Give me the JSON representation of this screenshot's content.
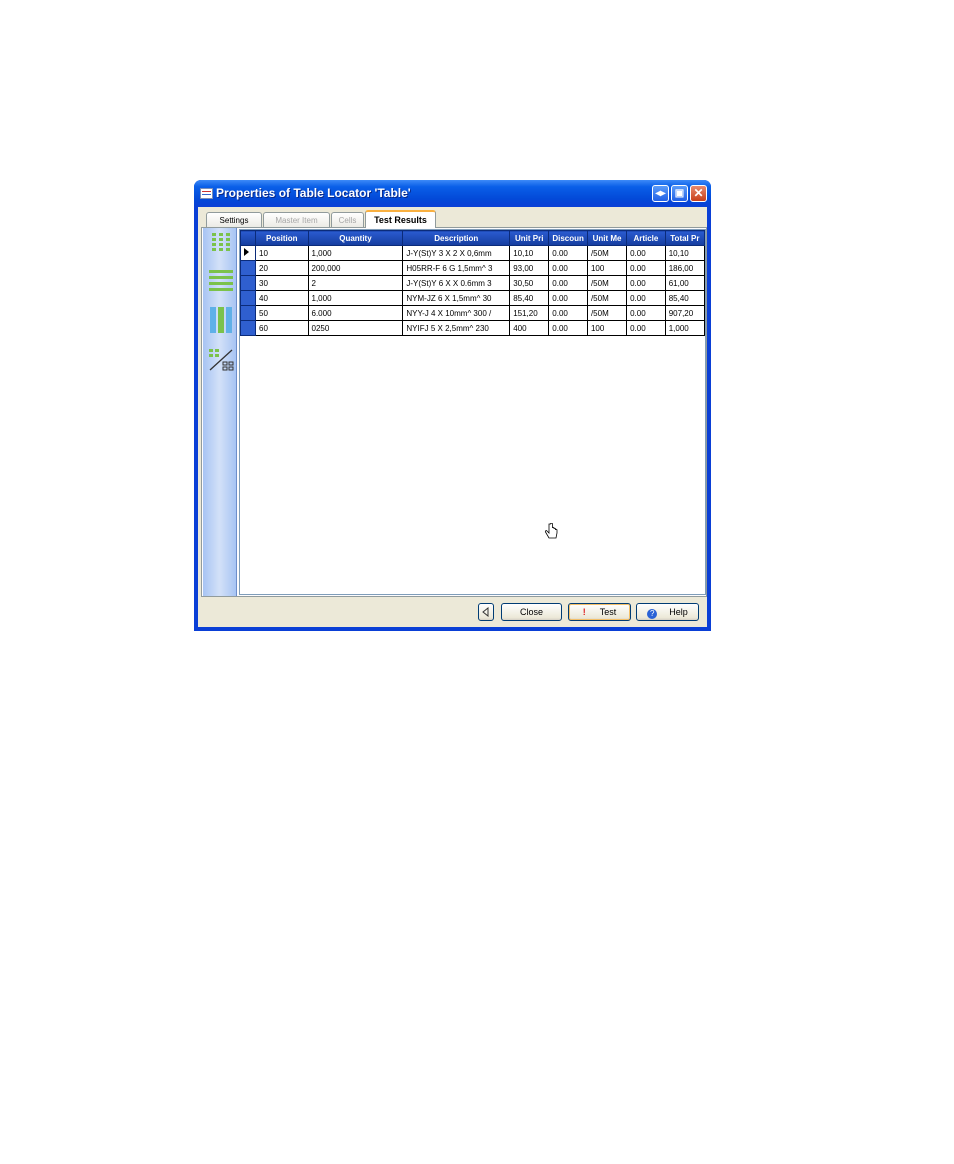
{
  "window": {
    "title": "Properties of Table Locator 'Table'"
  },
  "tabs": [
    {
      "label": "Settings",
      "state": "normal"
    },
    {
      "label": "Master Item",
      "state": "disabled"
    },
    {
      "label": "Cells",
      "state": "disabled"
    },
    {
      "label": "Test Results",
      "state": "active"
    }
  ],
  "toolbar": [
    "columns-grid-icon",
    "rows-grid-icon",
    "column-bars-icon",
    "split-grid-icon"
  ],
  "table": {
    "columns": [
      "Position",
      "Quantity",
      "Description",
      "Unit Pri",
      "Discoun",
      "Unit Me",
      "Article",
      "Total Pr"
    ],
    "rows": [
      [
        "10",
        "1,000",
        "J-Y(St)Y 3 X 2 X 0,6mm",
        "10,10",
        "0.00",
        "/50M",
        "0.00",
        "10,10"
      ],
      [
        "20",
        "200,000",
        "H05RR-F 6 G 1,5mm^ 3",
        "93,00",
        "0.00",
        "100",
        "0.00",
        "186,00"
      ],
      [
        "30",
        "2",
        "J-Y(St)Y 6 X X 0.6mm 3",
        "30,50",
        "0.00",
        "/50M",
        "0.00",
        "61,00"
      ],
      [
        "40",
        "1,000",
        "NYM-JZ 6 X 1,5mm^ 30",
        "85,40",
        "0.00",
        "/50M",
        "0.00",
        "85,40"
      ],
      [
        "50",
        "6.000",
        "NYY-J 4 X 10mm^ 300 /",
        "151,20",
        "0.00",
        "/50M",
        "0.00",
        "907,20"
      ],
      [
        "60",
        "0250",
        "NYIFJ 5 X 2,5mm^ 230",
        "400",
        "0.00",
        "100",
        "0.00",
        "1,000"
      ]
    ]
  },
  "buttons": {
    "close": "Close",
    "test": "Test",
    "help": "Help"
  }
}
